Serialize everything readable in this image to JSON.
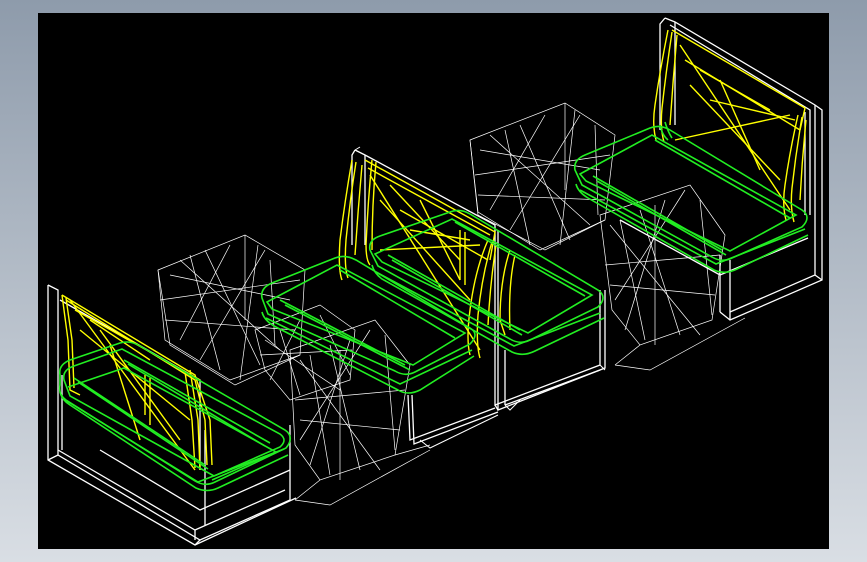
{
  "colors": {
    "frame_gradient_top": "#8e9bab",
    "frame_gradient_bottom": "#d9dee4",
    "viewport_background": "#000000",
    "wireframe_white": "#ffffff",
    "wireframe_yellow": "#ffff00",
    "wireframe_green": "#22ee22"
  },
  "scene": {
    "description_items": [
      {
        "name": "sofa-unit-1",
        "kind": "armchair-left"
      },
      {
        "name": "side-table-1",
        "kind": "table"
      },
      {
        "name": "sofa-unit-2",
        "kind": "sofa-middle"
      },
      {
        "name": "side-table-2",
        "kind": "table"
      },
      {
        "name": "sofa-unit-3",
        "kind": "armchair-right"
      }
    ]
  }
}
